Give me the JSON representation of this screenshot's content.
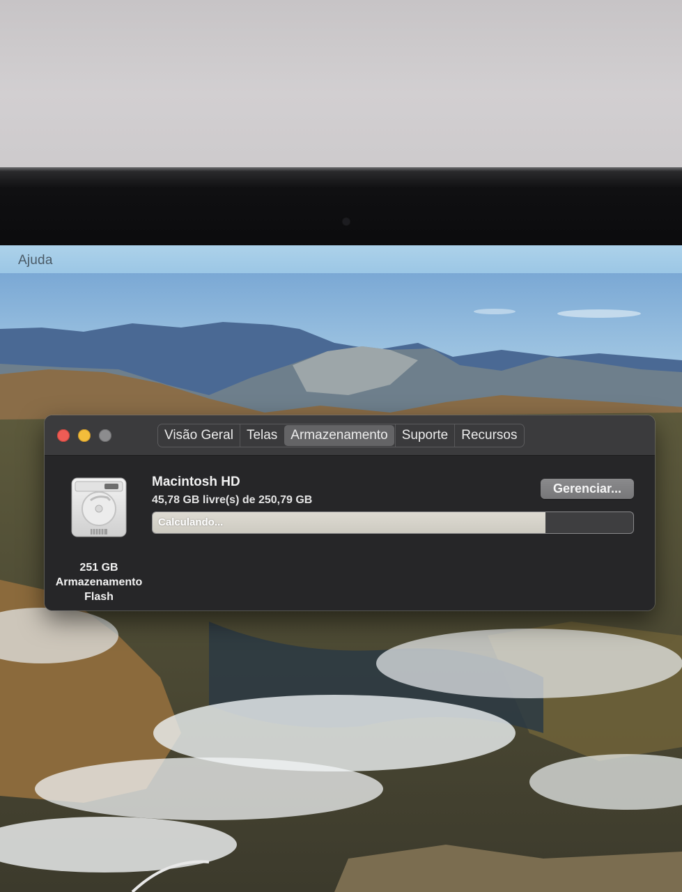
{
  "menubar": {
    "items": [
      "Ajuda"
    ]
  },
  "window": {
    "traffic_lights": [
      "close",
      "minimize",
      "zoom"
    ],
    "tabs": [
      {
        "label": "Visão Geral",
        "active": false
      },
      {
        "label": "Telas",
        "active": false
      },
      {
        "label": "Armazenamento",
        "active": true
      },
      {
        "label": "Suporte",
        "active": false
      },
      {
        "label": "Recursos",
        "active": false
      }
    ],
    "disk": {
      "icon": "hard-drive-icon",
      "capacity": "251 GB",
      "type_line1": "Armazenamento",
      "type_line2": "Flash"
    },
    "volume": {
      "name": "Macintosh HD",
      "free": "45,78 GB livre(s) de 250,79 GB",
      "usage_status": "Calculando...",
      "used_fraction": 0.818
    },
    "manage_button": "Gerenciar..."
  },
  "colors": {
    "close": "#ee5c55",
    "minimize": "#f3bd3b",
    "zoom": "#8c8c8e",
    "window_bg": "#262628",
    "usage_fill": "#dedbd2"
  }
}
